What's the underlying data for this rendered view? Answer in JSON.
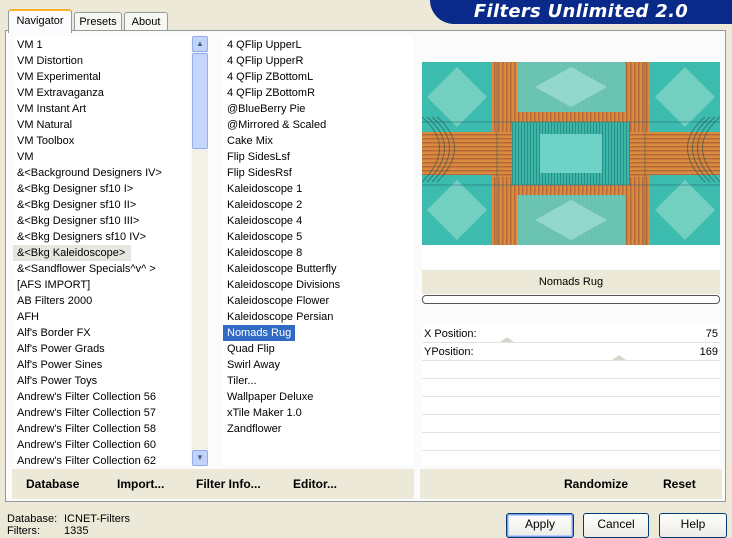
{
  "title": "Filters Unlimited 2.0",
  "tabs": [
    {
      "label": "Navigator",
      "active": true
    },
    {
      "label": "Presets",
      "active": false
    },
    {
      "label": "About",
      "active": false
    }
  ],
  "categories": [
    "VM 1",
    "VM Distortion",
    "VM Experimental",
    "VM Extravaganza",
    "VM Instant Art",
    "VM Natural",
    "VM Toolbox",
    "VM",
    "&<Background Designers IV>",
    "&<Bkg Designer sf10 I>",
    "&<Bkg Designer sf10 II>",
    "&<Bkg Designer sf10 III>",
    "&<Bkg Designers sf10 IV>",
    "&<Bkg Kaleidoscope>",
    "&<Sandflower Specials^v^ >",
    "[AFS IMPORT]",
    "AB Filters 2000",
    "AFH",
    "Alf's Border FX",
    "Alf's Power Grads",
    "Alf's Power Sines",
    "Alf's Power Toys",
    "Andrew's Filter Collection 56",
    "Andrew's Filter Collection 57",
    "Andrew's Filter Collection 58",
    "Andrew's Filter Collection 60",
    "Andrew's Filter Collection 62"
  ],
  "selected_category": "&<Bkg Kaleidoscope>",
  "filters": [
    "4 QFlip UpperL",
    "4 QFlip UpperR",
    "4 QFlip ZBottomL",
    "4 QFlip ZBottomR",
    "@BlueBerry Pie",
    "@Mirrored & Scaled",
    "Cake Mix",
    "Flip SidesLsf",
    "Flip SidesRsf",
    "Kaleidoscope 1",
    "Kaleidoscope 2",
    "Kaleidoscope 4",
    "Kaleidoscope 5",
    "Kaleidoscope 8",
    "Kaleidoscope Butterfly",
    "Kaleidoscope Divisions",
    "Kaleidoscope Flower",
    "Kaleidoscope Persian",
    "Nomads Rug",
    "Quad Flip",
    "Swirl Away",
    "Tiler...",
    "Wallpaper Deluxe",
    "xTile Maker 1.0",
    "Zandflower"
  ],
  "selected_filter": "Nomads Rug",
  "preview": {
    "filter_name": "Nomads Rug"
  },
  "params": [
    {
      "label": "X Position:",
      "value": "75"
    },
    {
      "label": "YPosition:",
      "value": "169"
    }
  ],
  "left_menu": {
    "database": "Database",
    "import": "Import...",
    "filter_info": "Filter Info...",
    "editor": "Editor..."
  },
  "right_menu": {
    "randomize": "Randomize",
    "reset": "Reset"
  },
  "status": {
    "database_label": "Database:",
    "database_value": "ICNET-Filters",
    "filters_label": "Filters:",
    "filters_value": "1335"
  },
  "buttons": {
    "apply": "Apply",
    "cancel": "Cancel",
    "help": "Help"
  },
  "colors": {
    "selection": "#316ac5",
    "banner": "#0a2a8a",
    "preview_teal": "#35b4a6",
    "preview_orange": "#d98c3e"
  }
}
